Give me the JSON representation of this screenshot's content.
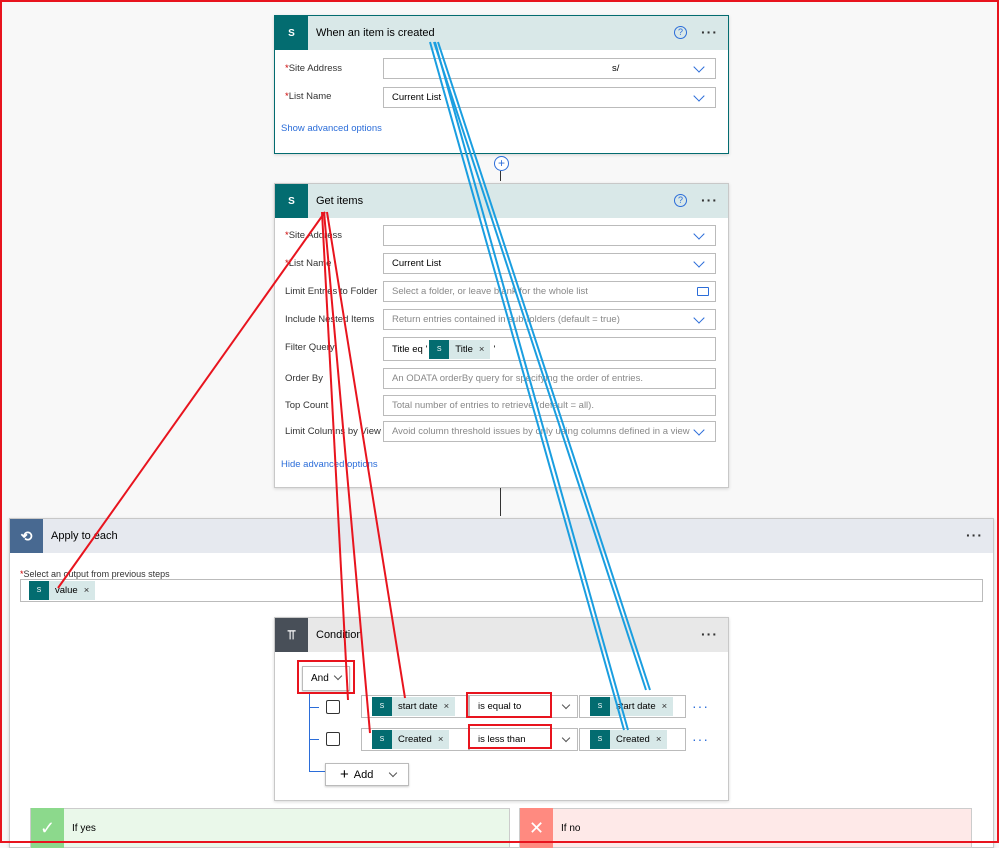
{
  "trigger": {
    "title": "When an item is created",
    "site_address_label": "Site Address",
    "site_address_value": "s/",
    "list_name_label": "List Name",
    "list_name_value": "Current List",
    "advanced_link": "Show advanced options"
  },
  "get_items": {
    "title": "Get items",
    "site_address_label": "Site Address",
    "list_name_label": "List Name",
    "list_name_value": "Current List",
    "limit_folder_label": "Limit Entries to Folder",
    "limit_folder_placeholder": "Select a folder, or leave blank for the whole list",
    "nested_label": "Include Nested Items",
    "nested_placeholder": "Return entries contained in sub-folders (default = true)",
    "filter_label": "Filter Query",
    "filter_prefix": "Title eq '",
    "filter_token": "Title",
    "filter_suffix": "'",
    "order_label": "Order By",
    "order_placeholder": "An ODATA orderBy query for specifying the order of entries.",
    "top_label": "Top Count",
    "top_placeholder": "Total number of entries to retrieve (default = all).",
    "columns_label": "Limit Columns by View",
    "columns_placeholder": "Avoid column threshold issues by only using columns defined in a view",
    "advanced_link": "Hide advanced options"
  },
  "apply_each": {
    "title": "Apply to each",
    "select_label": "Select an output from previous steps",
    "token": "value"
  },
  "condition": {
    "title": "Condition",
    "group_operator": "And",
    "rows": [
      {
        "left": "start date",
        "operator": "is equal to",
        "right": "start date"
      },
      {
        "left": "Created",
        "operator": "is less than",
        "right": "Created"
      }
    ],
    "add_label": "Add"
  },
  "branches": {
    "yes": "If yes",
    "no": "If no"
  },
  "icons": {
    "sharepoint": "S",
    "help": "?",
    "more": "···",
    "remove": "×"
  },
  "colors": {
    "sharepoint": "#036c70",
    "apply_each": "#486991",
    "condition": "#484f58",
    "yes": "#8cd98c",
    "no": "#ff8a80",
    "annotation_red": "#e8141e",
    "annotation_blue": "#1a9ee0"
  }
}
